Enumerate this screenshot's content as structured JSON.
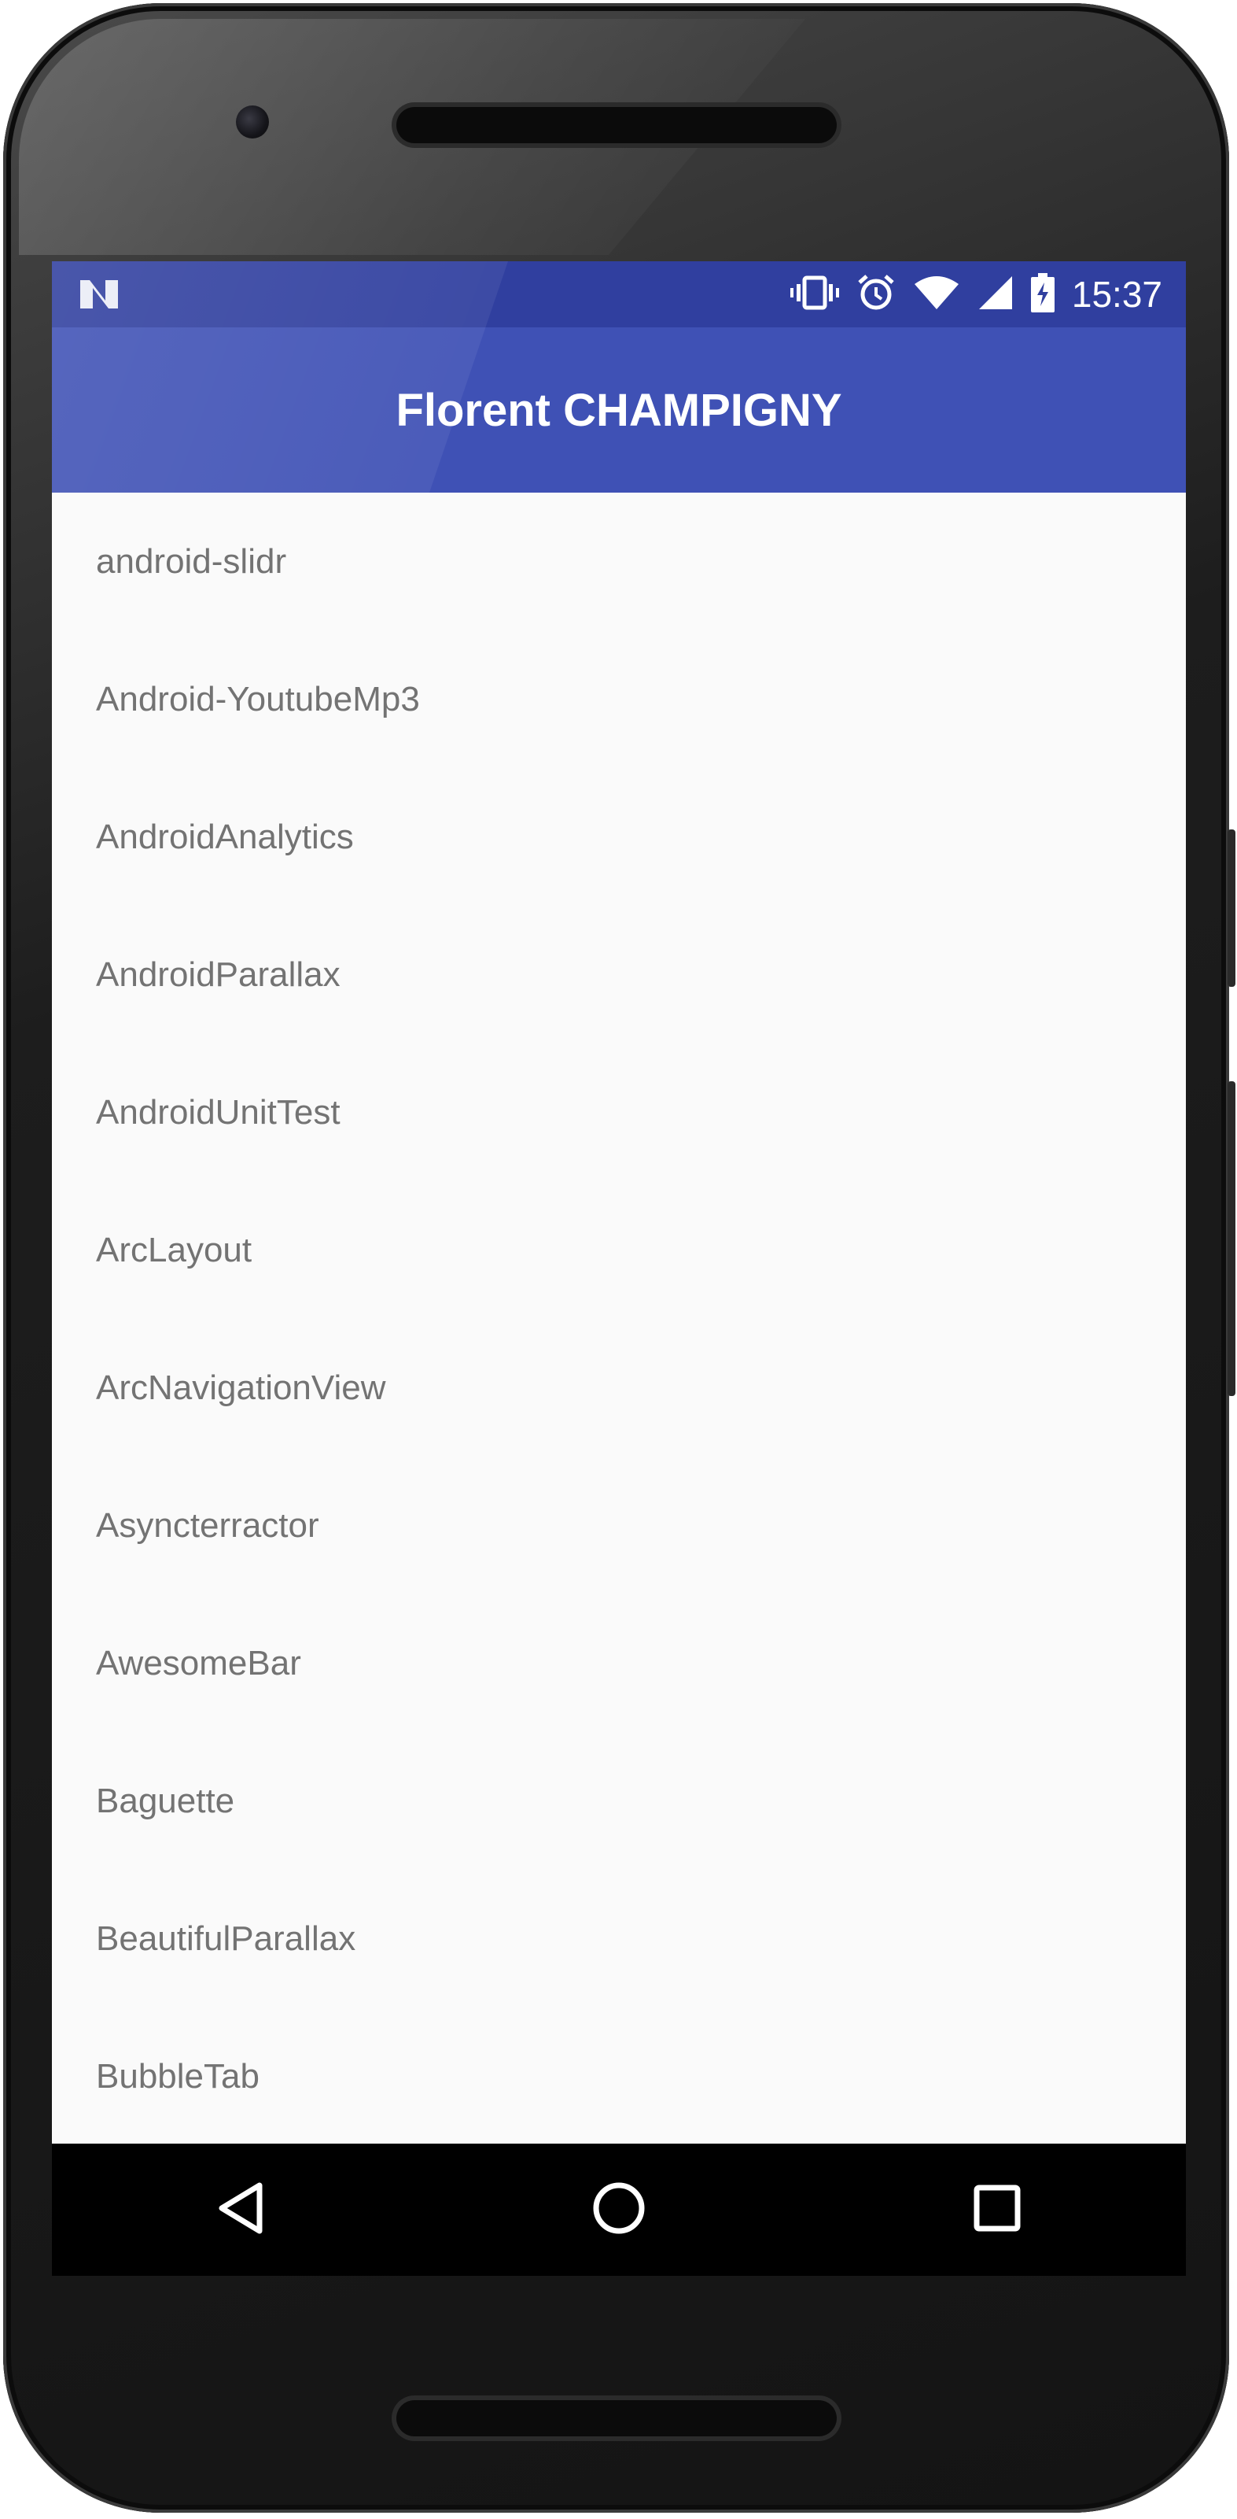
{
  "status_bar": {
    "time": "15:37",
    "icons": [
      "notification-n-icon",
      "vibrate-icon",
      "alarm-icon",
      "wifi-icon",
      "signal-icon",
      "battery-charging-icon"
    ]
  },
  "app_bar": {
    "title": "Florent CHAMPIGNY"
  },
  "repo_list": {
    "items": [
      {
        "label": "android-slidr"
      },
      {
        "label": "Android-YoutubeMp3"
      },
      {
        "label": "AndroidAnalytics"
      },
      {
        "label": "AndroidParallax"
      },
      {
        "label": "AndroidUnitTest"
      },
      {
        "label": "ArcLayout"
      },
      {
        "label": "ArcNavigationView"
      },
      {
        "label": "Asyncterractor"
      },
      {
        "label": "AwesomeBar"
      },
      {
        "label": "Baguette"
      },
      {
        "label": "BeautifulParallax"
      },
      {
        "label": "BubbleTab"
      }
    ]
  },
  "nav_bar": {
    "buttons": [
      "back-icon",
      "home-icon",
      "recents-icon"
    ]
  },
  "colors": {
    "status_bar": "#303f9f",
    "app_bar": "#3f51b5",
    "list_background": "#fafafa",
    "list_text": "#737373"
  }
}
